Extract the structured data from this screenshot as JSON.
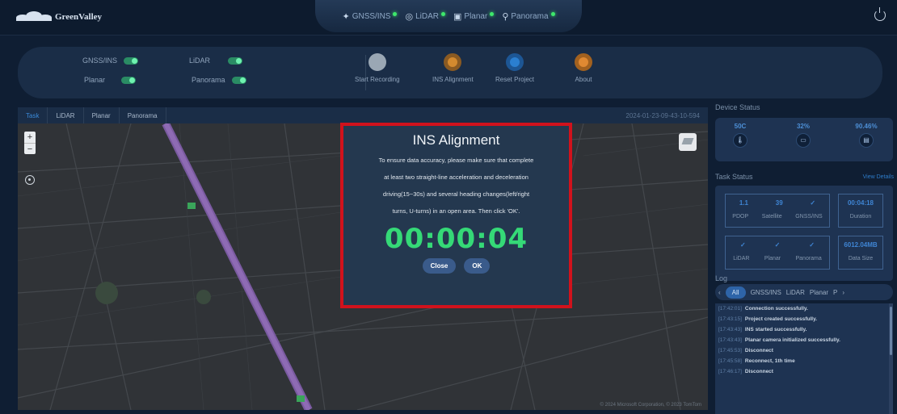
{
  "header": {
    "logo_text": "GreenValley",
    "modes": [
      {
        "label": "GNSS/INS",
        "icon": "satellite-icon"
      },
      {
        "label": "LiDAR",
        "icon": "lidar-icon"
      },
      {
        "label": "Planar",
        "icon": "camera-icon"
      },
      {
        "label": "Panorama",
        "icon": "pin-icon"
      }
    ]
  },
  "controls": {
    "toggles": [
      {
        "label": "GNSS/INS",
        "on": true
      },
      {
        "label": "LiDAR",
        "on": true
      },
      {
        "label": "Planar",
        "on": true
      },
      {
        "label": "Panorama",
        "on": true
      }
    ],
    "actions": [
      {
        "label": "Start Recording",
        "color": "#9aa7b4"
      },
      {
        "label": "INS Alignment",
        "color": "#d38a2f"
      },
      {
        "label": "Reset Project",
        "color": "#2b7fd0"
      },
      {
        "label": "About",
        "color": "#e08932"
      }
    ]
  },
  "map_panel": {
    "tabs": [
      "Task",
      "LiDAR",
      "Planar",
      "Panorama"
    ],
    "active_tab": "Task",
    "timestamp": "2024-01-23-09-43-10-594",
    "copyright": "© 2024 Microsoft Corporation, © 2023 TomTom"
  },
  "modal": {
    "title": "INS Alignment",
    "body_lines": [
      "To ensure data accuracy, please make sure that complete",
      "at least two straight-line acceleration and deceleration",
      "driving(15~30s) and several heading changes(left/right",
      "turns, U-turns) in an open area. Then click 'OK'."
    ],
    "timer": "00:00:04",
    "close_label": "Close",
    "ok_label": "OK"
  },
  "device_status": {
    "title": "Device Status",
    "items": [
      {
        "value": "50C",
        "icon": "thermometer-icon"
      },
      {
        "value": "32%",
        "icon": "memory-icon"
      },
      {
        "value": "90.46%",
        "icon": "storage-icon"
      }
    ]
  },
  "task_status": {
    "title": "Task Status",
    "view_details": "View Details",
    "values": [
      "1.1",
      "39",
      "✓",
      "00:04:18"
    ],
    "labels": [
      "PDOP",
      "Satellite",
      "GNSS/INS",
      "Duration"
    ],
    "values2": [
      "✓",
      "✓",
      "✓",
      "6012.04MB"
    ],
    "labels2": [
      "LiDAR",
      "Planar",
      "Panorama",
      "Data Size"
    ]
  },
  "log": {
    "title": "Log",
    "tabs": [
      "All",
      "GNSS/INS",
      "LiDAR",
      "Planar",
      "P"
    ],
    "entries": [
      {
        "time": "[17:42:01]",
        "msg": "Connection successfully."
      },
      {
        "time": "[17:43:15]",
        "msg": "Project created successfully."
      },
      {
        "time": "[17:43:43]",
        "msg": "INS started successfully."
      },
      {
        "time": "[17:43:43]",
        "msg": "Planar camera initialized successfully."
      },
      {
        "time": "[17:45:53]",
        "msg": "Disconnect"
      },
      {
        "time": "[17:45:58]",
        "msg": "Reconnect, 1th time"
      },
      {
        "time": "[17:46:17]",
        "msg": "Disconnect"
      }
    ]
  }
}
